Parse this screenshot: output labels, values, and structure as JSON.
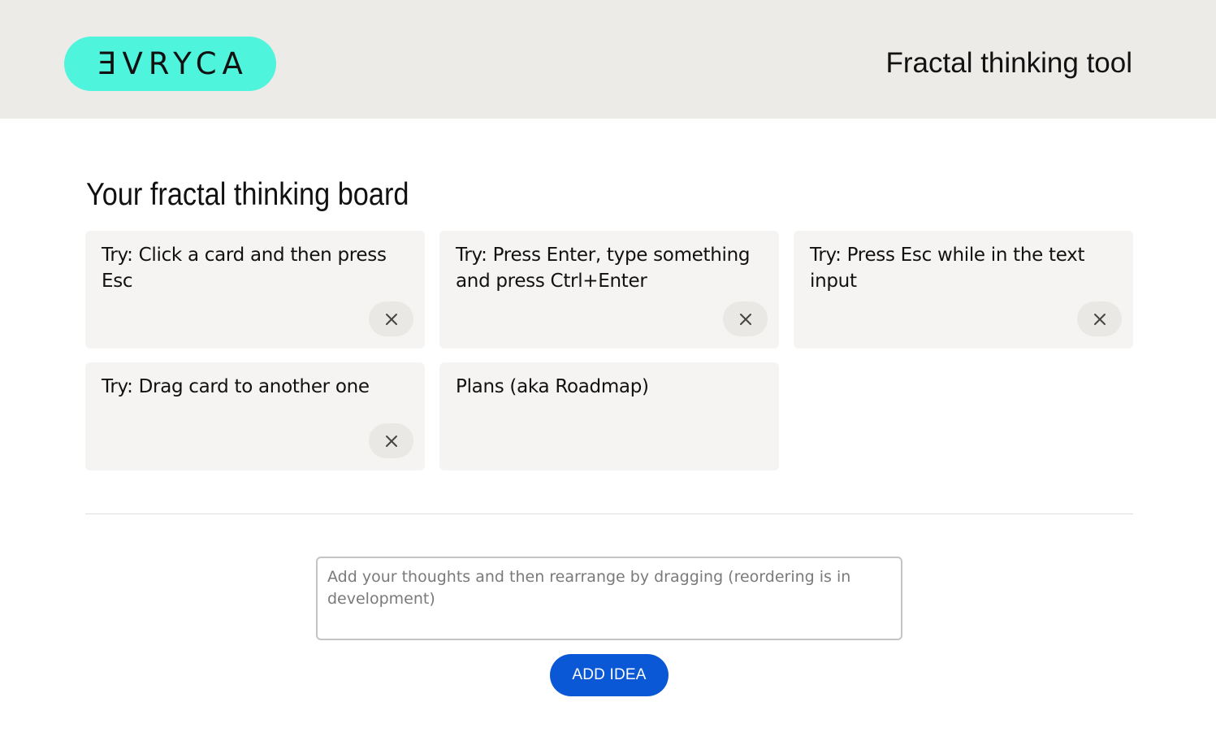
{
  "header": {
    "logo_text": "ƎVRYCA",
    "app_title": "Fractal thinking tool"
  },
  "board": {
    "title": "Your fractal thinking board",
    "cards": [
      {
        "text": "Try: Click a card and then press Esc",
        "has_close": true,
        "close_icon": "close-icon"
      },
      {
        "text": "Try: Press Enter, type something and press Ctrl+Enter",
        "has_close": true,
        "close_icon": "close-icon"
      },
      {
        "text": "Try: Press Esc while in the text input",
        "has_close": true,
        "close_icon": "close-icon"
      },
      {
        "text": "Try: Drag card to another one",
        "has_close": true,
        "close_icon": "close-icon"
      },
      {
        "text": "Plans (aka Roadmap)",
        "has_close": false
      }
    ]
  },
  "composer": {
    "value": "",
    "placeholder": "Add your thoughts and then rearrange by dragging (reordering is in development)",
    "add_label": "ADD IDEA"
  },
  "colors": {
    "logo_bg": "#4ef4dc",
    "header_bg": "#ecebe8",
    "card_bg": "#f5f4f2",
    "primary_button": "#0a58d6"
  }
}
